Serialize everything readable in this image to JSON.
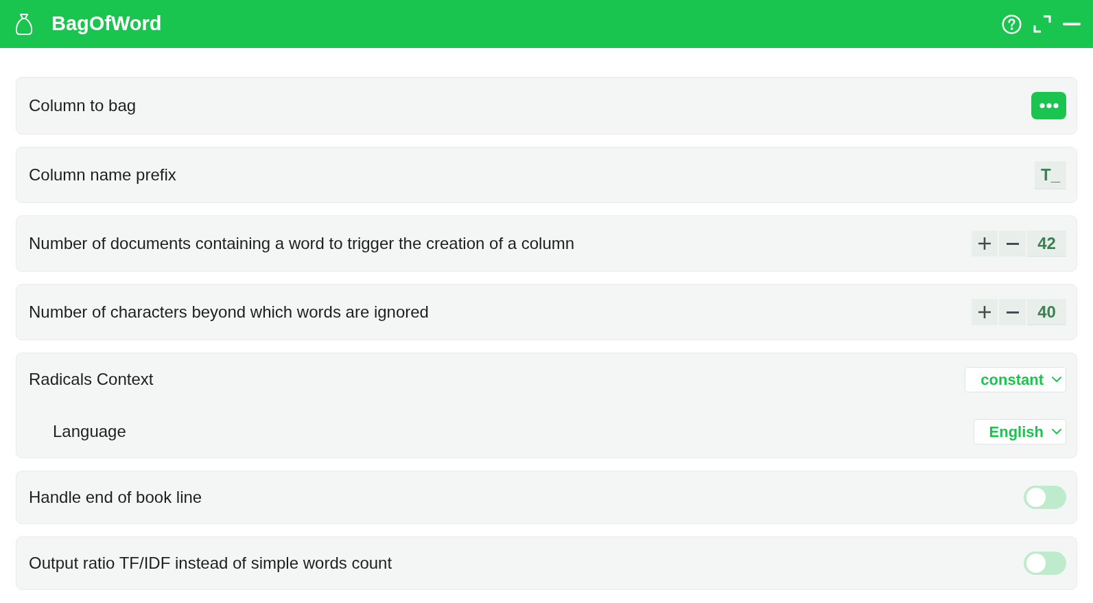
{
  "window": {
    "title": "BagOfWord"
  },
  "settings": [
    {
      "kind": "picker",
      "label": "Column to bag"
    },
    {
      "kind": "text",
      "label": "Column name prefix",
      "value": "T_"
    },
    {
      "kind": "number",
      "label": "Number of documents containing a word to trigger the creation of a column",
      "value": "42"
    },
    {
      "kind": "number",
      "label": "Number of characters beyond which words are ignored",
      "value": "40"
    },
    {
      "kind": "select",
      "label": "Radicals Context",
      "value": "constant",
      "children": [
        {
          "kind": "select",
          "label": "Language",
          "value": "English"
        }
      ]
    },
    {
      "kind": "toggle",
      "label": "Handle end of book line",
      "on": false
    },
    {
      "kind": "toggle",
      "label": "Output ratio TF/IDF instead of simple words count",
      "on": false
    }
  ]
}
